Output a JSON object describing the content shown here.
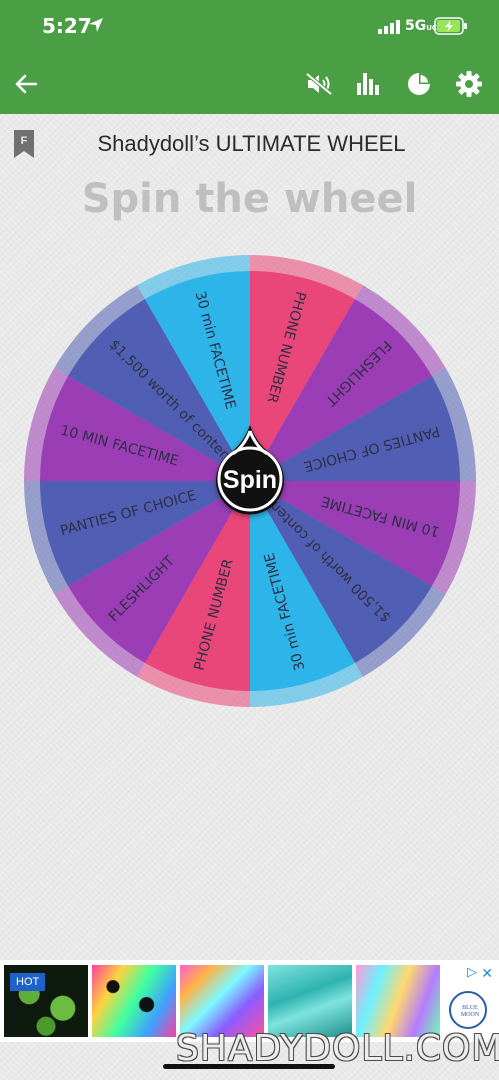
{
  "status": {
    "time": "5:27",
    "network": "5G",
    "network_suffix": "UC"
  },
  "toolbar": {
    "icons": [
      "back-arrow-icon",
      "mute-icon",
      "stats-icon",
      "pie-chart-icon",
      "settings-icon"
    ]
  },
  "wheel": {
    "badge": "F",
    "title": "Shadydoll’s ULTIMATE WHEEL",
    "heading": "Spin the wheel",
    "spin_label": "Spin",
    "segments": [
      {
        "label": "PHONE NUMBER",
        "color": "#e94679"
      },
      {
        "label": "FLESHLIGHT",
        "color": "#9b3db5"
      },
      {
        "label": "PANTIES OF CHOICE",
        "color": "#505fb3"
      },
      {
        "label": "10 MIN FACETIME",
        "color": "#9b3db5"
      },
      {
        "label": "$1,500 worth of content",
        "color": "#505fb3"
      },
      {
        "label": "30 min FACETIME",
        "color": "#2db5ea"
      },
      {
        "label": "PHONE NUMBER",
        "color": "#e94679"
      },
      {
        "label": "FLESHLIGHT",
        "color": "#9b3db5"
      },
      {
        "label": "PANTIES OF CHOICE",
        "color": "#505fb3"
      },
      {
        "label": "10 MIN FACETIME",
        "color": "#9b3db5"
      },
      {
        "label": "$1,500 worth of content",
        "color": "#505fb3"
      },
      {
        "label": "30 min FACETIME",
        "color": "#2db5ea"
      }
    ]
  },
  "ad": {
    "hot_label": "HOT",
    "brand": "BLUE MOON"
  },
  "watermark": "SHADYDOLL.COM"
}
